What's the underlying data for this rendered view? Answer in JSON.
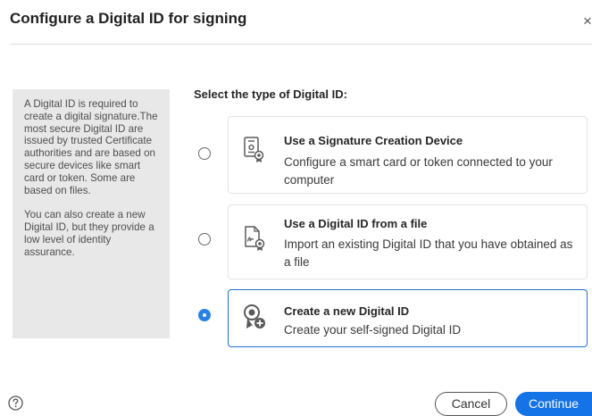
{
  "dialog": {
    "title": "Configure a Digital ID for signing",
    "close_label": "×"
  },
  "sidebar": {
    "paragraph1": "A Digital ID is required to create a digital signature.The most secure Digital ID are issued by trusted Certificate authorities and are based on secure devices like smart card or token. Some are based on files.",
    "paragraph2": "You can also create a new Digital ID, but they provide a low level of identity assurance."
  },
  "main": {
    "heading": "Select the type of Digital ID:",
    "options": [
      {
        "title": "Use a Signature Creation Device",
        "description": "Configure a smart card or token connected to your computer",
        "icon": "signature-device-icon",
        "selected": false
      },
      {
        "title": "Use a Digital ID from a file",
        "description": "Import an existing Digital ID that you have obtained as a file",
        "icon": "digital-id-file-icon",
        "selected": false
      },
      {
        "title": "Create a new Digital ID",
        "description": "Create your self-signed Digital ID",
        "icon": "new-digital-id-icon",
        "selected": true
      }
    ]
  },
  "footer": {
    "help_icon": "help-icon",
    "cancel_label": "Cancel",
    "continue_label": "Continue"
  },
  "colors": {
    "accent": "#1473e6",
    "sidebar_bg": "#e8e8e8",
    "selected_border": "#1f6fd8"
  }
}
